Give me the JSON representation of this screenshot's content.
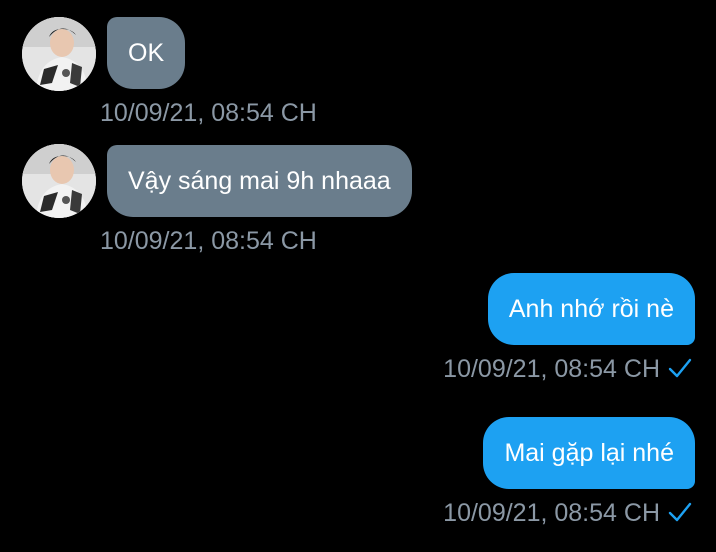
{
  "conversation": {
    "messages": [
      {
        "direction": "incoming",
        "text": "OK",
        "timestamp": "10/09/21, 08:54 CH"
      },
      {
        "direction": "incoming",
        "text": "Vậy sáng mai 9h nhaaa",
        "timestamp": "10/09/21, 08:54 CH"
      },
      {
        "direction": "outgoing",
        "text": "Anh nhớ rồi nè",
        "timestamp": "10/09/21, 08:54 CH",
        "status_icon": "check-icon"
      },
      {
        "direction": "outgoing",
        "text": "Mai gặp lại nhé",
        "timestamp": "10/09/21, 08:54 CH",
        "status_icon": "check-icon"
      }
    ]
  },
  "colors": {
    "background": "#000000",
    "incoming_bubble": "#6a7d8c",
    "outgoing_bubble": "#1da1f2",
    "timestamp": "#8b98a5",
    "check": "#1da1f2"
  }
}
